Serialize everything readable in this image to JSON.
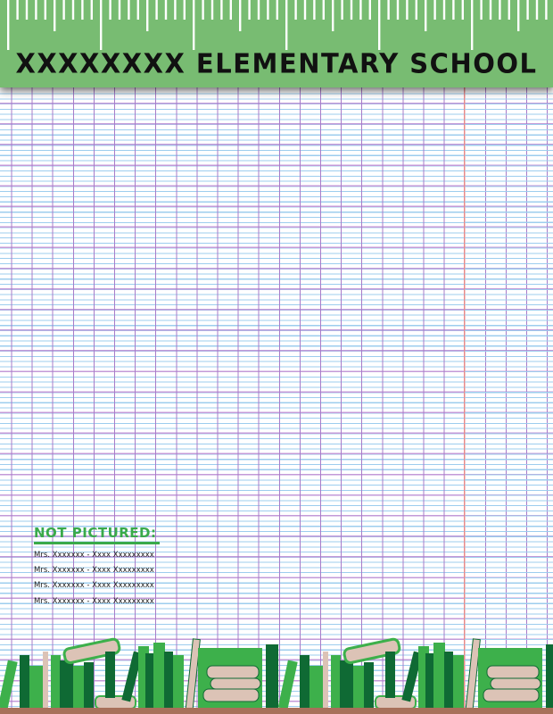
{
  "header": {
    "title": "XXXXXXXX ELEMENTARY SCHOOL"
  },
  "not_pictured": {
    "heading": "NOT PICTURED:",
    "entries": [
      "Mrs. Xxxxxxx - Xxxx Xxxxxxxxx",
      "Mrs. Xxxxxxx - Xxxx Xxxxxxxxx",
      "Mrs. Xxxxxxx - Xxxx Xxxxxxxxx",
      "Mrs. Xxxxxxx - Xxxx Xxxxxxxxx"
    ]
  },
  "colors": {
    "ruler": "#78bc72",
    "accent": "#3aaa4a",
    "book_dark": "#0f6a34",
    "book_light": "#3db04b",
    "page_tan": "#dcc3b6",
    "shelf": "#a8705a"
  }
}
